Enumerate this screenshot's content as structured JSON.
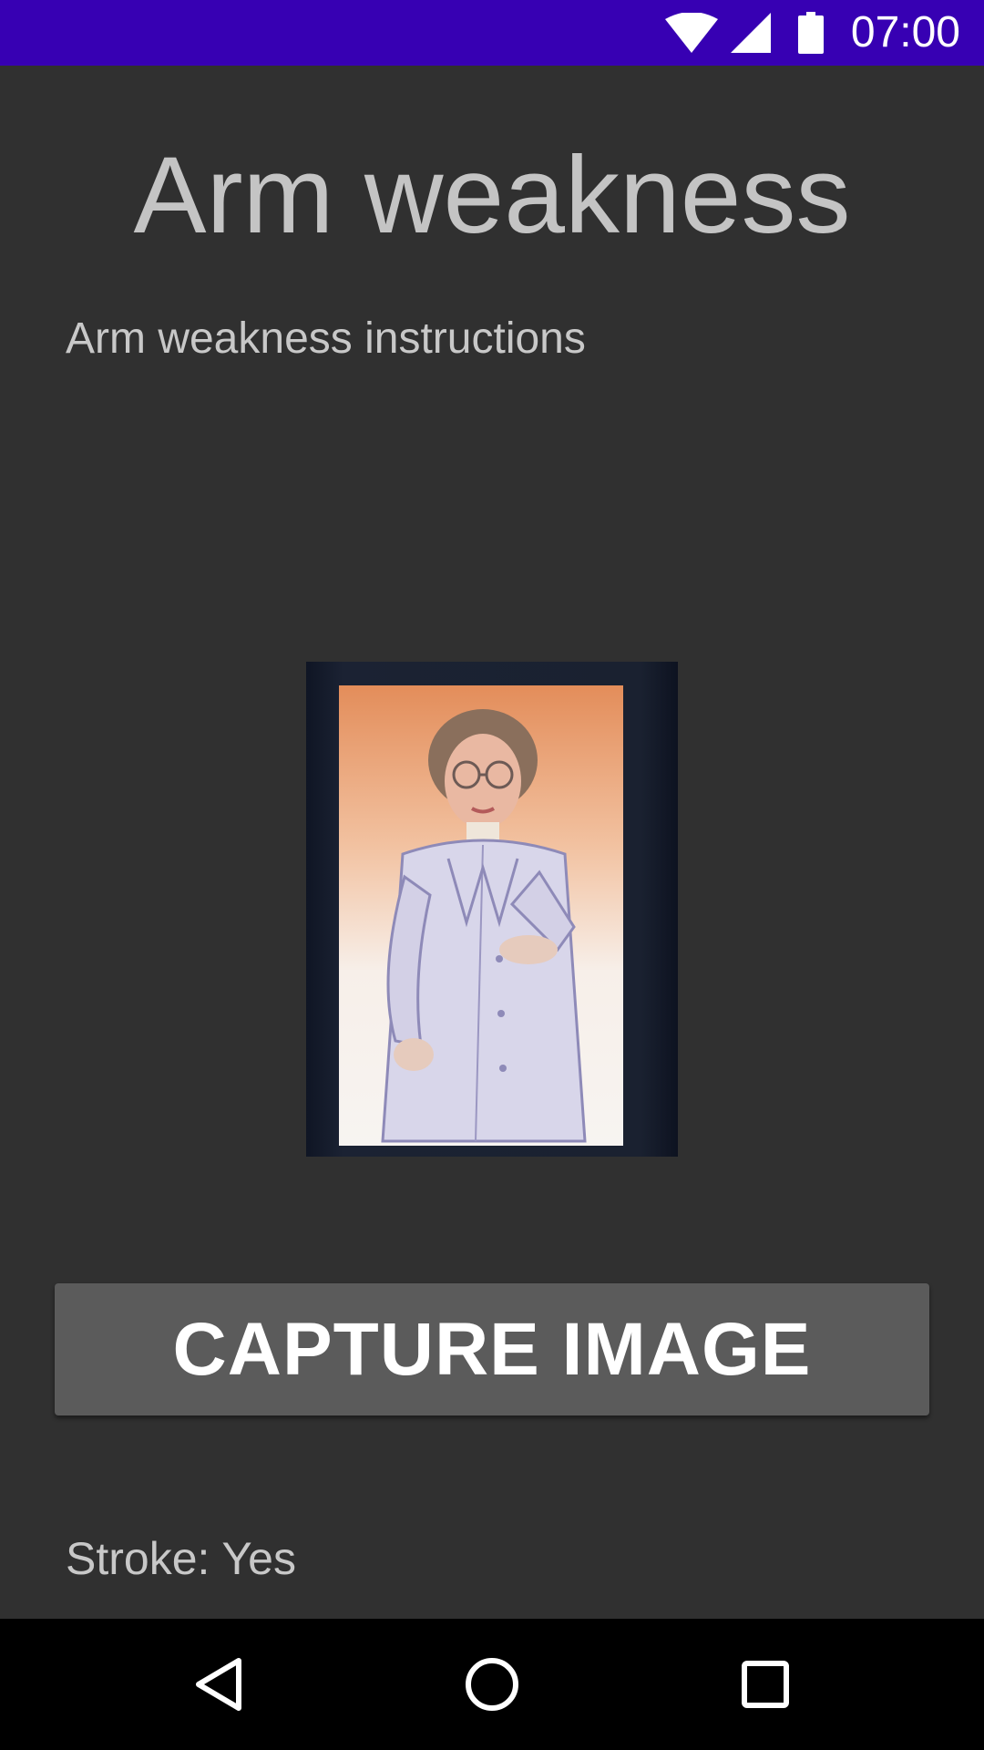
{
  "status_bar": {
    "time": "07:00",
    "icons": [
      "wifi-icon",
      "cell-signal-icon",
      "battery-icon"
    ],
    "background": "#3700b3"
  },
  "screen": {
    "title": "Arm weakness",
    "instructions": "Arm weakness instructions",
    "capture_button_label": "CAPTURE IMAGE",
    "stroke_result": "Stroke: Yes",
    "background": "#303030"
  },
  "nav_bar": {
    "buttons": [
      "back-icon",
      "home-icon",
      "recents-icon"
    ]
  }
}
